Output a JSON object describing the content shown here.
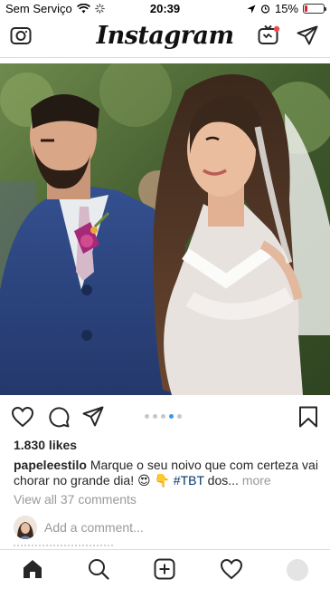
{
  "status_bar": {
    "carrier": "Sem Serviço",
    "time": "20:39",
    "battery_text": "15%",
    "battery_level": 0.15
  },
  "header": {
    "logo_text": "Instagram"
  },
  "post": {
    "carousel": {
      "count": 5,
      "active_index": 3
    },
    "likes": "1.830 likes",
    "caption": {
      "username": "papeleestilo",
      "text_1": "Marque o seu noivo que com certeza vai chorar no grande dia! ",
      "emojis": "😍 👇 ",
      "hashtag": "#TBT",
      "text_2": " dos...",
      "more": "more"
    },
    "view_comments": "View all 37 comments",
    "add_comment_placeholder": "Add a comment..."
  },
  "tab_bar": {
    "items": [
      "home-icon",
      "search-icon",
      "new-post-icon",
      "activity-icon",
      "profile-avatar"
    ]
  },
  "colors": {
    "link": "#003569",
    "muted": "#999999",
    "carousel_active": "#3897f0",
    "battery_low": "#e0212b"
  }
}
